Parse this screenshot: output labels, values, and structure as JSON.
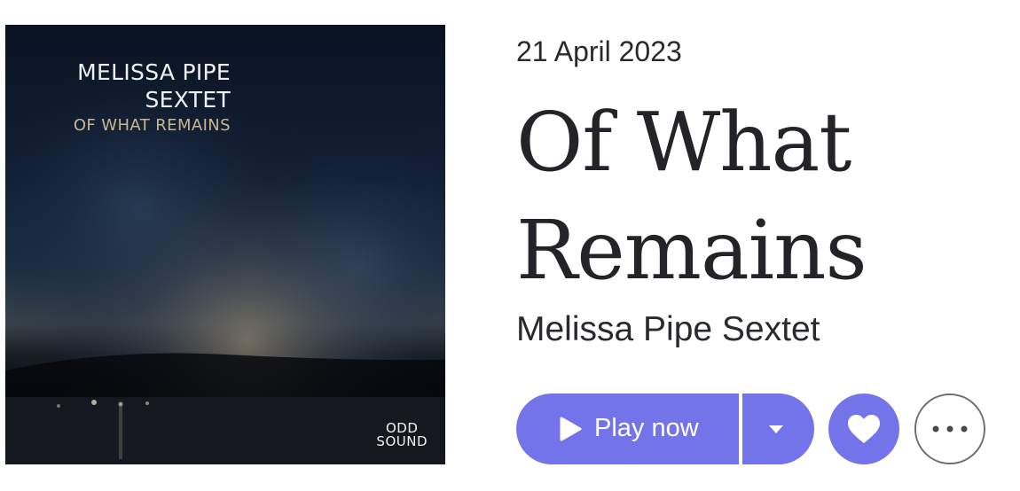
{
  "cover": {
    "artist_line1": "MELISSA PIPE",
    "artist_line2": "SEXTET",
    "title": "OF WHAT REMAINS",
    "label_line1": "ODD",
    "label_line2": "SOUND"
  },
  "album": {
    "release_date": "21 April 2023",
    "title_line1": "Of What",
    "title_line2": "Remains",
    "artist": "Melissa Pipe Sextet"
  },
  "actions": {
    "play_label": "Play now",
    "play_icon": "play-icon",
    "options_icon": "caret-down-icon",
    "favorite_icon": "heart-icon",
    "more_icon": "ellipsis-icon"
  },
  "colors": {
    "accent": "#7474ea",
    "text": "#242428",
    "cover_bg": "#0b1322",
    "cover_title": "#c9b68f"
  }
}
